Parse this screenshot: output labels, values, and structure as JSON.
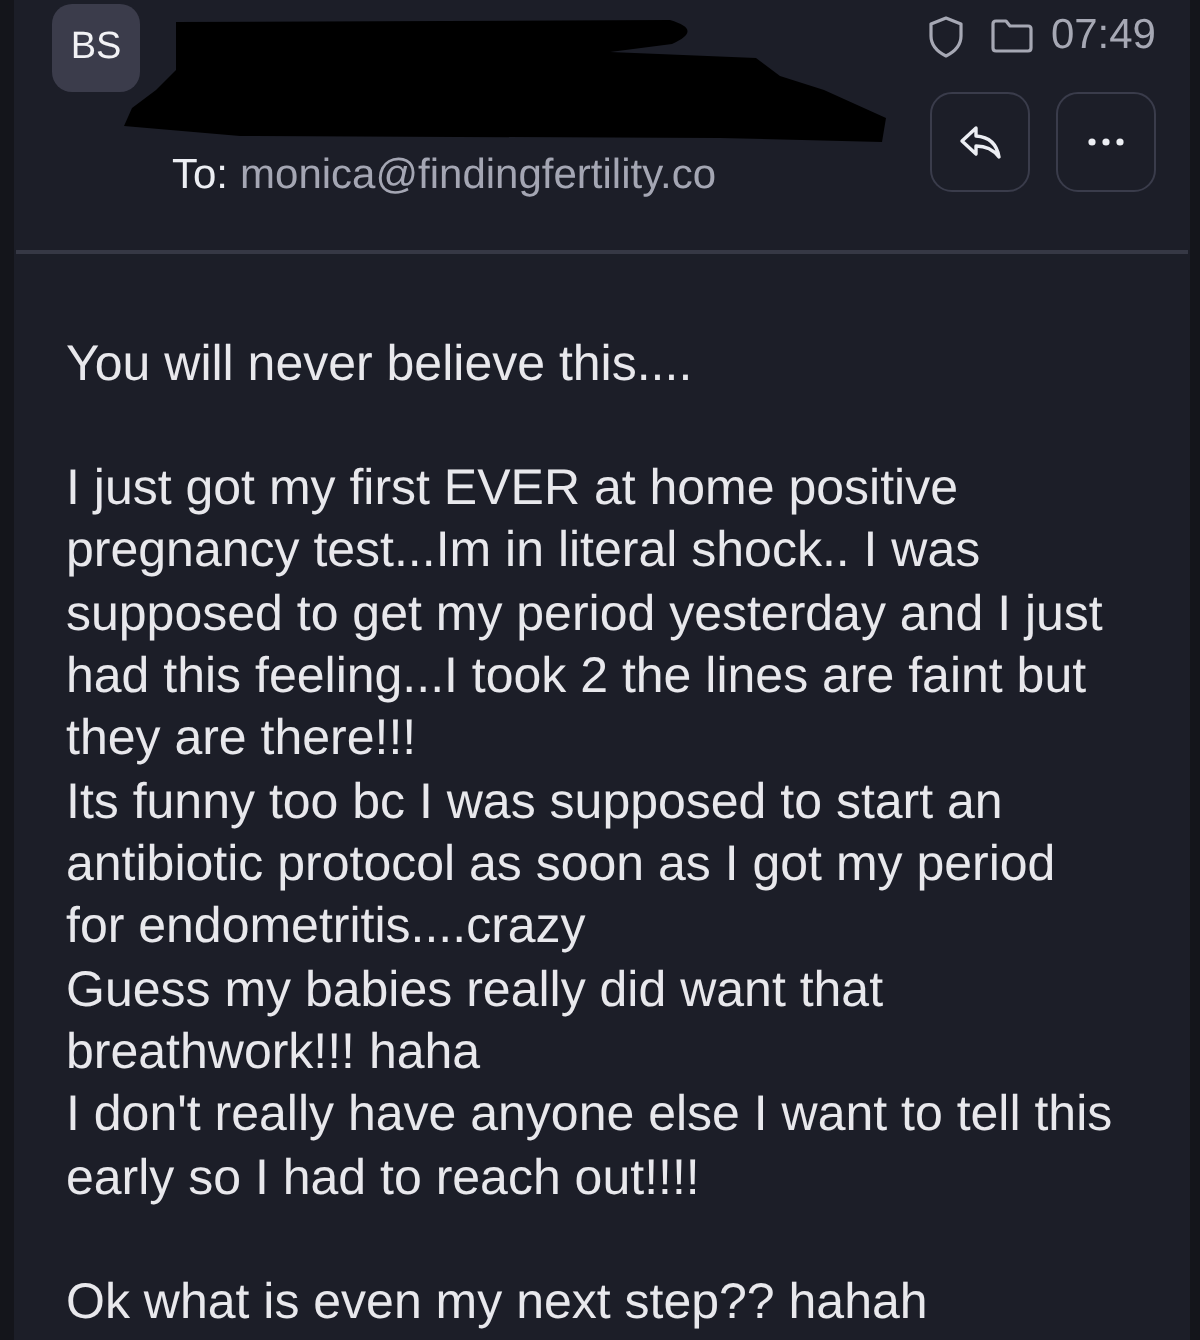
{
  "header": {
    "avatar": {
      "initials": "BS"
    },
    "sender_redacted": true,
    "to_label": "To:",
    "recipient": "monica@findingfertility.co",
    "time": "07:49"
  },
  "body": {
    "paragraphs": [
      [
        "You will never believe this...."
      ],
      [
        "I just got my first EVER at home positive pregnancy test...Im in literal shock.. I was supposed to get my period yesterday and I just had this feeling...I took 2 the lines are faint but they are there!!!",
        "Its funny too bc I was supposed to start an antibiotic protocol as soon as I got my period for endometritis....crazy",
        "Guess my babies really did want that breathwork!!! haha",
        "I don't really have anyone else I want to tell this early so I had to reach out!!!!"
      ],
      [
        "Ok what is even my next step?? hahah"
      ]
    ]
  }
}
